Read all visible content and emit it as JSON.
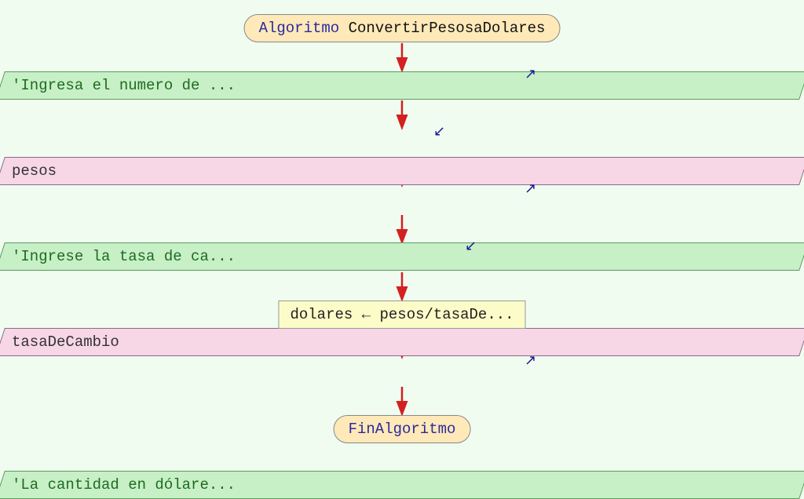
{
  "flowchart": {
    "start": {
      "keyword": "Algoritmo",
      "name": "ConvertirPesosaDolares"
    },
    "steps": [
      {
        "type": "output",
        "text": "'Ingresa el numero de ..."
      },
      {
        "type": "input",
        "text": "pesos"
      },
      {
        "type": "output",
        "text": "'Ingrese la tasa de ca..."
      },
      {
        "type": "input",
        "text": "tasaDeCambio"
      },
      {
        "type": "process",
        "text": "dolares ← pesos/tasaDe..."
      },
      {
        "type": "output",
        "text": "'La cantidad en dólare..."
      }
    ],
    "end": {
      "keyword": "FinAlgoritmo"
    }
  },
  "colors": {
    "background": "#f0fcf0",
    "terminal_fill": "#ffe9b8",
    "output_fill": "#c7f0c7",
    "input_fill": "#f7d6e6",
    "process_fill": "#fcfcc8",
    "connector": "#d42020"
  }
}
